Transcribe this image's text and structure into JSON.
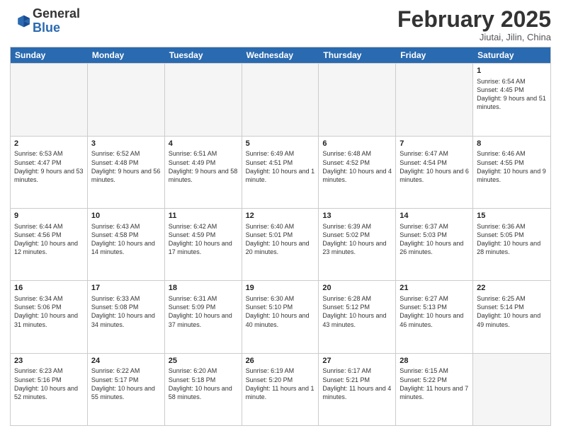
{
  "logo": {
    "general": "General",
    "blue": "Blue"
  },
  "title": "February 2025",
  "location": "Jiutai, Jilin, China",
  "weekdays": [
    "Sunday",
    "Monday",
    "Tuesday",
    "Wednesday",
    "Thursday",
    "Friday",
    "Saturday"
  ],
  "weeks": [
    [
      {
        "day": "",
        "info": ""
      },
      {
        "day": "",
        "info": ""
      },
      {
        "day": "",
        "info": ""
      },
      {
        "day": "",
        "info": ""
      },
      {
        "day": "",
        "info": ""
      },
      {
        "day": "",
        "info": ""
      },
      {
        "day": "1",
        "info": "Sunrise: 6:54 AM\nSunset: 4:45 PM\nDaylight: 9 hours and 51 minutes."
      }
    ],
    [
      {
        "day": "2",
        "info": "Sunrise: 6:53 AM\nSunset: 4:47 PM\nDaylight: 9 hours and 53 minutes."
      },
      {
        "day": "3",
        "info": "Sunrise: 6:52 AM\nSunset: 4:48 PM\nDaylight: 9 hours and 56 minutes."
      },
      {
        "day": "4",
        "info": "Sunrise: 6:51 AM\nSunset: 4:49 PM\nDaylight: 9 hours and 58 minutes."
      },
      {
        "day": "5",
        "info": "Sunrise: 6:49 AM\nSunset: 4:51 PM\nDaylight: 10 hours and 1 minute."
      },
      {
        "day": "6",
        "info": "Sunrise: 6:48 AM\nSunset: 4:52 PM\nDaylight: 10 hours and 4 minutes."
      },
      {
        "day": "7",
        "info": "Sunrise: 6:47 AM\nSunset: 4:54 PM\nDaylight: 10 hours and 6 minutes."
      },
      {
        "day": "8",
        "info": "Sunrise: 6:46 AM\nSunset: 4:55 PM\nDaylight: 10 hours and 9 minutes."
      }
    ],
    [
      {
        "day": "9",
        "info": "Sunrise: 6:44 AM\nSunset: 4:56 PM\nDaylight: 10 hours and 12 minutes."
      },
      {
        "day": "10",
        "info": "Sunrise: 6:43 AM\nSunset: 4:58 PM\nDaylight: 10 hours and 14 minutes."
      },
      {
        "day": "11",
        "info": "Sunrise: 6:42 AM\nSunset: 4:59 PM\nDaylight: 10 hours and 17 minutes."
      },
      {
        "day": "12",
        "info": "Sunrise: 6:40 AM\nSunset: 5:01 PM\nDaylight: 10 hours and 20 minutes."
      },
      {
        "day": "13",
        "info": "Sunrise: 6:39 AM\nSunset: 5:02 PM\nDaylight: 10 hours and 23 minutes."
      },
      {
        "day": "14",
        "info": "Sunrise: 6:37 AM\nSunset: 5:03 PM\nDaylight: 10 hours and 26 minutes."
      },
      {
        "day": "15",
        "info": "Sunrise: 6:36 AM\nSunset: 5:05 PM\nDaylight: 10 hours and 28 minutes."
      }
    ],
    [
      {
        "day": "16",
        "info": "Sunrise: 6:34 AM\nSunset: 5:06 PM\nDaylight: 10 hours and 31 minutes."
      },
      {
        "day": "17",
        "info": "Sunrise: 6:33 AM\nSunset: 5:08 PM\nDaylight: 10 hours and 34 minutes."
      },
      {
        "day": "18",
        "info": "Sunrise: 6:31 AM\nSunset: 5:09 PM\nDaylight: 10 hours and 37 minutes."
      },
      {
        "day": "19",
        "info": "Sunrise: 6:30 AM\nSunset: 5:10 PM\nDaylight: 10 hours and 40 minutes."
      },
      {
        "day": "20",
        "info": "Sunrise: 6:28 AM\nSunset: 5:12 PM\nDaylight: 10 hours and 43 minutes."
      },
      {
        "day": "21",
        "info": "Sunrise: 6:27 AM\nSunset: 5:13 PM\nDaylight: 10 hours and 46 minutes."
      },
      {
        "day": "22",
        "info": "Sunrise: 6:25 AM\nSunset: 5:14 PM\nDaylight: 10 hours and 49 minutes."
      }
    ],
    [
      {
        "day": "23",
        "info": "Sunrise: 6:23 AM\nSunset: 5:16 PM\nDaylight: 10 hours and 52 minutes."
      },
      {
        "day": "24",
        "info": "Sunrise: 6:22 AM\nSunset: 5:17 PM\nDaylight: 10 hours and 55 minutes."
      },
      {
        "day": "25",
        "info": "Sunrise: 6:20 AM\nSunset: 5:18 PM\nDaylight: 10 hours and 58 minutes."
      },
      {
        "day": "26",
        "info": "Sunrise: 6:19 AM\nSunset: 5:20 PM\nDaylight: 11 hours and 1 minute."
      },
      {
        "day": "27",
        "info": "Sunrise: 6:17 AM\nSunset: 5:21 PM\nDaylight: 11 hours and 4 minutes."
      },
      {
        "day": "28",
        "info": "Sunrise: 6:15 AM\nSunset: 5:22 PM\nDaylight: 11 hours and 7 minutes."
      },
      {
        "day": "",
        "info": ""
      }
    ]
  ]
}
